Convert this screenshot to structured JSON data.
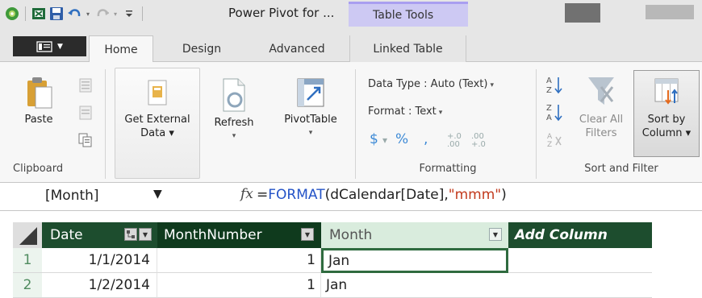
{
  "title_bar": {
    "title": "Power Pivot for ...",
    "contextual_tab_group": "Table Tools"
  },
  "tabs": {
    "file_label": "",
    "home": "Home",
    "design": "Design",
    "advanced": "Advanced",
    "linked_table": "Linked Table",
    "active": "Home"
  },
  "ribbon": {
    "clipboard": {
      "paste": "Paste",
      "group_label": "Clipboard"
    },
    "get_external_data": {
      "line1": "Get External",
      "line2": "Data ▾"
    },
    "refresh": {
      "label": "Refresh",
      "caret": "▾"
    },
    "pivottable": {
      "label": "PivotTable",
      "caret": "▾"
    },
    "formatting": {
      "data_type": "Data Type : Auto (Text)",
      "format": "Format : Text",
      "group_label": "Formatting"
    },
    "sort_filter": {
      "clear_all_line1": "Clear All",
      "clear_all_line2": "Filters",
      "sort_by_line1": "Sort by",
      "sort_by_line2": "Column ▾",
      "group_label": "Sort and Filter"
    }
  },
  "formula_bar": {
    "name_box": "[Month]",
    "fx": "fx",
    "formula_eq": "=",
    "formula_fn": "FORMAT",
    "formula_arg": "(dCalendar[Date],",
    "formula_str": "\"mmm\"",
    "formula_end": ")"
  },
  "grid": {
    "columns": [
      "Date",
      "MonthNumber",
      "Month",
      "Add Column"
    ],
    "rows": [
      {
        "num": "1",
        "date": "1/1/2014",
        "month_number": "1",
        "month": "Jan"
      },
      {
        "num": "2",
        "date": "1/2/2014",
        "month_number": "1",
        "month": "Jan"
      }
    ]
  },
  "colors": {
    "header_dark_green": "#1d4d2e",
    "selected_column_header": "#d9ecdd",
    "contextual_tab": "#cdc9f3",
    "formula_keyword": "#2453c7"
  }
}
